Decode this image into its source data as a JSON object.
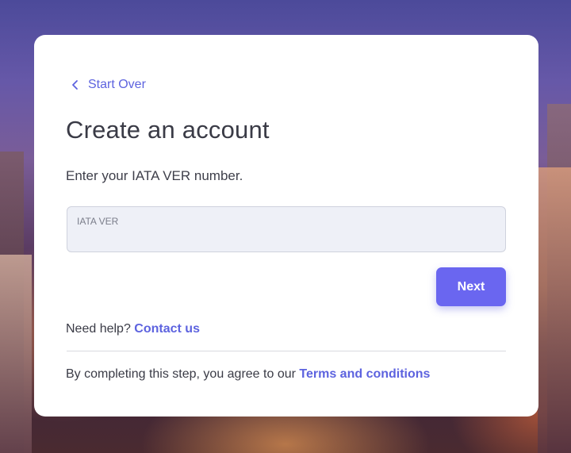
{
  "header": {
    "back_label": "Start Over",
    "title": "Create an account",
    "subtitle": "Enter your IATA VER number."
  },
  "form": {
    "iata_label": "IATA VER",
    "iata_value": "",
    "next_label": "Next"
  },
  "help": {
    "prefix": "Need help?",
    "link": "Contact us"
  },
  "terms": {
    "prefix": "By completing this step, you agree to our",
    "link": "Terms and conditions"
  },
  "colors": {
    "accent": "#5d63df",
    "button": "#6a66f0",
    "field_bg": "#eef0f7"
  }
}
